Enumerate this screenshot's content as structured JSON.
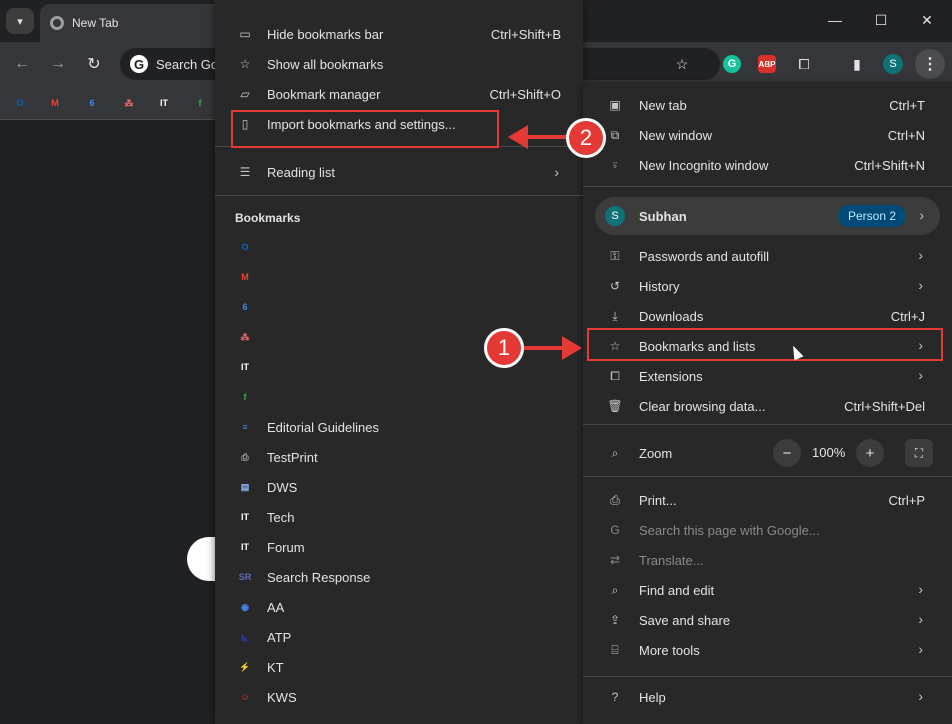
{
  "browser": {
    "tab_title": "New Tab",
    "omnibox_placeholder": "Search Go",
    "toolbar_avatar_initial": "S",
    "toolbar_icons": [
      "back-icon",
      "forward-icon",
      "reload-icon",
      "bookmark-star-icon",
      "grammarly-icon",
      "adblock-icon",
      "extensions-icon",
      "side-panel-icon",
      "profile-avatar",
      "kebab-menu-icon"
    ],
    "grammarly_letter": "G",
    "adblock_text": "ABP",
    "window_controls": {
      "minimize": "—",
      "maximize": "☐",
      "close": "✕"
    }
  },
  "bookmarks_bar": {
    "icons": [
      {
        "name": "outlook-icon",
        "glyph": "O",
        "color": "#0a64c8"
      },
      {
        "name": "gmail-icon",
        "glyph": "M",
        "color": "#ea4335"
      },
      {
        "name": "calendar-icon",
        "glyph": "6",
        "color": "#4285f4"
      },
      {
        "name": "asana-icon",
        "glyph": "⁂",
        "color": "#f06a6a"
      },
      {
        "name": "it-logo-icon",
        "glyph": "IT",
        "color": "#ffffff"
      },
      {
        "name": "feedly-icon",
        "glyph": "f",
        "color": "#2bb24c"
      }
    ]
  },
  "bookmarks_submenu": {
    "items": [
      {
        "label": "Hide bookmarks bar",
        "shortcut": "Ctrl+Shift+B",
        "icon": "bookmarks-bar-icon"
      },
      {
        "label": "Show all bookmarks",
        "shortcut": "",
        "icon": "star-list-icon"
      },
      {
        "label": "Bookmark manager",
        "shortcut": "Ctrl+Shift+O",
        "icon": "bookmark-manager-icon"
      },
      {
        "label": "Import bookmarks and settings...",
        "shortcut": "",
        "icon": "import-icon"
      }
    ],
    "reading_list_label": "Reading list",
    "section_heading": "Bookmarks",
    "bookmarks": [
      {
        "label": "",
        "icon": "outlook-icon",
        "glyph": "O",
        "color": "#0a64c8"
      },
      {
        "label": "",
        "icon": "gmail-icon",
        "glyph": "M",
        "color": "#ea4335"
      },
      {
        "label": "",
        "icon": "calendar-icon",
        "glyph": "6",
        "color": "#4285f4"
      },
      {
        "label": "",
        "icon": "asana-icon",
        "glyph": "⁂",
        "color": "#f06a6a"
      },
      {
        "label": "",
        "icon": "it-logo-icon",
        "glyph": "IT",
        "color": "#ffffff"
      },
      {
        "label": "",
        "icon": "feedly-icon",
        "glyph": "f",
        "color": "#2bb24c"
      },
      {
        "label": "Editorial Guidelines",
        "icon": "docs-icon",
        "glyph": "≡",
        "color": "#4285f4"
      },
      {
        "label": "TestPrint",
        "icon": "printer-icon",
        "glyph": "⎙",
        "color": "#9aa0a6"
      },
      {
        "label": "DWS",
        "icon": "document-icon",
        "glyph": "▤",
        "color": "#8ab4f8"
      },
      {
        "label": "Tech",
        "icon": "it-logo-icon",
        "glyph": "IT",
        "color": "#ffffff"
      },
      {
        "label": "Forum",
        "icon": "it-logo-icon",
        "glyph": "IT",
        "color": "#ffffff"
      },
      {
        "label": "Search Response",
        "icon": "sr-icon",
        "glyph": "SR",
        "color": "#5c6bc0"
      },
      {
        "label": "AA",
        "icon": "eye-icon",
        "glyph": "◉",
        "color": "#4285f4"
      },
      {
        "label": "ATP",
        "icon": "atp-icon",
        "glyph": "◣",
        "color": "#283593"
      },
      {
        "label": "KT",
        "icon": "kt-icon",
        "glyph": "⚡",
        "color": "#7c4dff"
      },
      {
        "label": "KWS",
        "icon": "kws-icon",
        "glyph": "☺",
        "color": "#e53935"
      }
    ]
  },
  "main_menu": {
    "group1": [
      {
        "label": "New tab",
        "shortcut": "Ctrl+T",
        "icon": "new-tab-icon",
        "glyph": "▣"
      },
      {
        "label": "New window",
        "shortcut": "Ctrl+N",
        "icon": "new-window-icon",
        "glyph": "⧉"
      },
      {
        "label": "New Incognito window",
        "shortcut": "Ctrl+Shift+N",
        "icon": "incognito-icon",
        "glyph": "⍤"
      }
    ],
    "profile": {
      "initial": "S",
      "name": "Subhan",
      "badge": "Person 2"
    },
    "group2": [
      {
        "label": "Passwords and autofill",
        "shortcut": "",
        "arrow": true,
        "icon": "key-icon",
        "glyph": "⚿"
      },
      {
        "label": "History",
        "shortcut": "",
        "arrow": true,
        "icon": "history-icon",
        "glyph": "↺"
      },
      {
        "label": "Downloads",
        "shortcut": "Ctrl+J",
        "arrow": false,
        "icon": "download-icon",
        "glyph": "⤓"
      },
      {
        "label": "Bookmarks and lists",
        "shortcut": "",
        "arrow": true,
        "icon": "star-icon",
        "glyph": "☆"
      },
      {
        "label": "Extensions",
        "shortcut": "",
        "arrow": true,
        "icon": "puzzle-icon",
        "glyph": "⧠"
      },
      {
        "label": "Clear browsing data...",
        "shortcut": "Ctrl+Shift+Del",
        "arrow": false,
        "icon": "trash-icon",
        "glyph": "🗑"
      }
    ],
    "zoom": {
      "label": "Zoom",
      "value": "100%",
      "minus": "−",
      "plus": "+"
    },
    "group3": [
      {
        "label": "Print...",
        "shortcut": "Ctrl+P",
        "arrow": false,
        "dim": false,
        "icon": "print-icon",
        "glyph": "⎙"
      },
      {
        "label": "Search this page with Google...",
        "shortcut": "",
        "arrow": false,
        "dim": true,
        "icon": "google-icon",
        "glyph": "G"
      },
      {
        "label": "Translate...",
        "shortcut": "",
        "arrow": false,
        "dim": true,
        "icon": "translate-icon",
        "glyph": "⇄"
      },
      {
        "label": "Find and edit",
        "shortcut": "",
        "arrow": true,
        "dim": false,
        "icon": "find-icon",
        "glyph": "⌕"
      },
      {
        "label": "Save and share",
        "shortcut": "",
        "arrow": true,
        "dim": false,
        "icon": "share-icon",
        "glyph": "⇪"
      },
      {
        "label": "More tools",
        "shortcut": "",
        "arrow": true,
        "dim": false,
        "icon": "toolbox-icon",
        "glyph": "⌸"
      }
    ],
    "help_label": "Help"
  },
  "annotations": {
    "callout_1": "1",
    "callout_2": "2",
    "accent": "#e53935"
  }
}
